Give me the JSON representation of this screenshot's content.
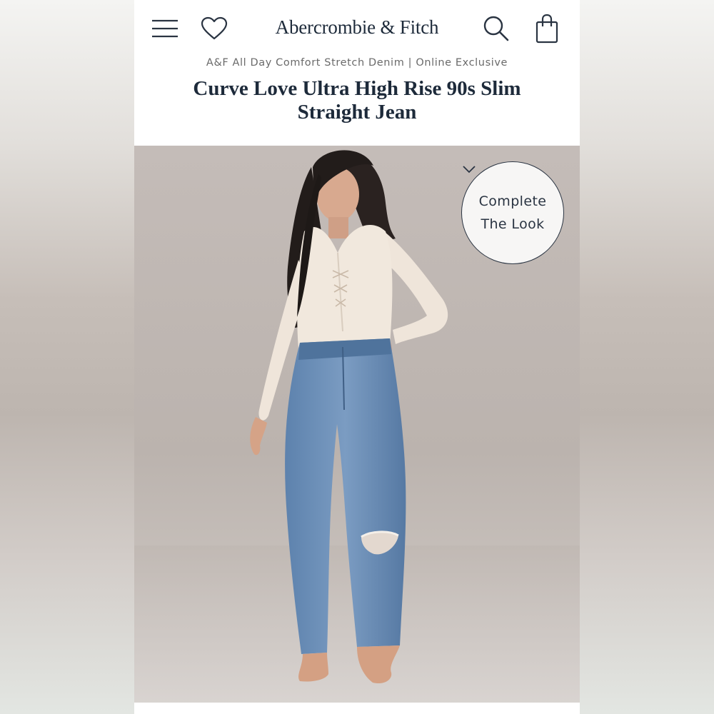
{
  "header": {
    "logo": "Abercrombie & Fitch",
    "icons": [
      "menu-icon",
      "heart-icon",
      "search-icon",
      "bag-icon"
    ]
  },
  "product": {
    "collection": "A&F All Day Comfort Stretch Denim | Online Exclusive",
    "name": "Curve Love Ultra High Rise 90s Slim Straight Jean"
  },
  "complete_the_look": {
    "line1": "Complete",
    "line2": "The Look",
    "icon": "chevron-down-icon"
  },
  "colors": {
    "brand_navy": "#1d2a3a",
    "subtitle_gray": "#6a6a6a",
    "photo_background": "#c0b8b3",
    "denim": "#6a8db4"
  }
}
